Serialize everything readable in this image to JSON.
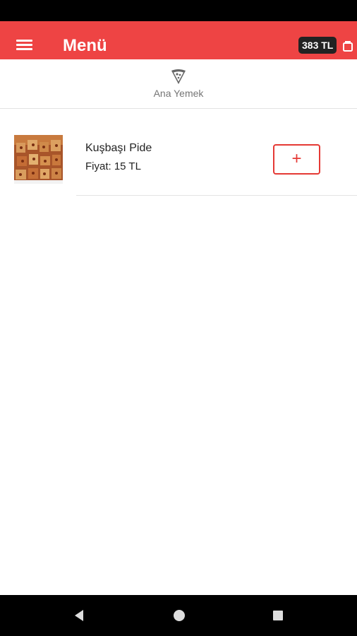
{
  "app_bar": {
    "title": "Menü",
    "cart_total": "383 TL",
    "background_color": "#ee4444"
  },
  "icons": {
    "menu": "hamburger-menu-icon",
    "cart": "cart-icon",
    "category": "pizza-slice-icon",
    "add": "plus-icon",
    "nav_back": "back-triangle-icon",
    "nav_home": "home-circle-icon",
    "nav_recents": "recents-square-icon"
  },
  "categories": [
    {
      "label": "Ana Yemek",
      "icon": "pizza-slice-icon"
    }
  ],
  "products": [
    {
      "name": "Kuşbaşı Pide",
      "price": "Fiyat: 15 TL",
      "add_label": "+"
    }
  ],
  "colors": {
    "accent": "#e53935",
    "cart_badge": "#222222",
    "secondary_text": "#757575"
  }
}
